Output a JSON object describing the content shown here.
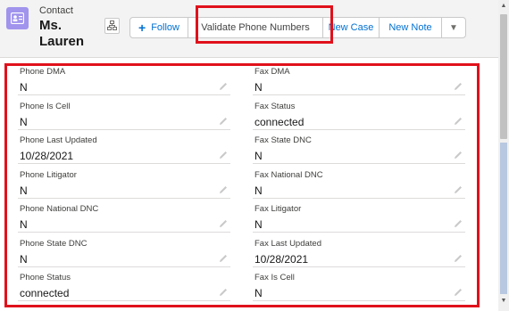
{
  "header": {
    "object_label": "Contact",
    "record_name": "Ms. Lauren",
    "actions": {
      "follow": "Follow",
      "validate_phone": "Validate Phone Numbers",
      "new_case": "New Case",
      "new_note": "New Note"
    }
  },
  "fields_left": [
    {
      "label": "Phone DMA",
      "value": "N"
    },
    {
      "label": "Phone Is Cell",
      "value": "N"
    },
    {
      "label": "Phone Last Updated",
      "value": "10/28/2021"
    },
    {
      "label": "Phone Litigator",
      "value": "N"
    },
    {
      "label": "Phone National DNC",
      "value": "N"
    },
    {
      "label": "Phone State DNC",
      "value": "N"
    },
    {
      "label": "Phone Status",
      "value": "connected"
    }
  ],
  "fields_right": [
    {
      "label": "Fax DMA",
      "value": "N"
    },
    {
      "label": "Fax Status",
      "value": "connected"
    },
    {
      "label": "Fax State DNC",
      "value": "N"
    },
    {
      "label": "Fax National DNC",
      "value": "N"
    },
    {
      "label": "Fax Litigator",
      "value": "N"
    },
    {
      "label": "Fax Last Updated",
      "value": "10/28/2021"
    },
    {
      "label": "Fax Is Cell",
      "value": "N"
    }
  ],
  "colors": {
    "highlight": "#e0111b",
    "accent": "#0070d2",
    "contact_icon": "#a094ed"
  },
  "icons": [
    "contact-card-icon",
    "hierarchy-icon",
    "plus-icon",
    "chevron-down-icon",
    "pencil-icon"
  ]
}
